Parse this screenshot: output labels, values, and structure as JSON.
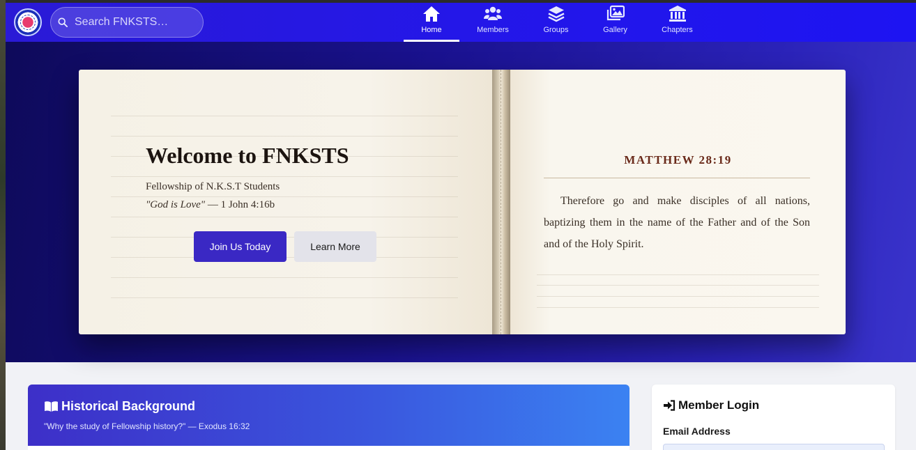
{
  "colors": {
    "navbar": "#2417e8",
    "hero_bg": "#1a1290",
    "primary_button": "#3a28c4",
    "secondary_button": "#e3e3ea",
    "verse_reference": "#6a2a1a"
  },
  "navbar": {
    "logo_icon": "fellowship-logo-icon",
    "search": {
      "placeholder": "Search FNKSTS…",
      "icon": "search-icon"
    },
    "items": [
      {
        "label": "Home",
        "icon": "home-icon",
        "active": true
      },
      {
        "label": "Members",
        "icon": "users-icon",
        "active": false
      },
      {
        "label": "Groups",
        "icon": "layers-icon",
        "active": false
      },
      {
        "label": "Gallery",
        "icon": "images-icon",
        "active": false
      },
      {
        "label": "Chapters",
        "icon": "landmark-icon",
        "active": false
      }
    ]
  },
  "hero": {
    "title": "Welcome to FNKSTS",
    "subtitle": "Fellowship of N.K.S.T Students",
    "quote": "\"God is Love\"",
    "quote_ref": " — 1 John 4:16b",
    "join_label": "Join Us Today",
    "learn_label": "Learn More",
    "verse_reference": "MATTHEW 28:19",
    "verse_text": "Therefore go and make disciples of all nations, baptizing them in the name of the Father and of the Son and of the Holy Spirit."
  },
  "history": {
    "icon": "book-open-icon",
    "title": "Historical Background",
    "subtitle": "\"Why the study of Fellowship history?\" — Exodus 16:32"
  },
  "login": {
    "icon": "sign-in-icon",
    "title": "Member Login",
    "email_label": "Email Address"
  }
}
